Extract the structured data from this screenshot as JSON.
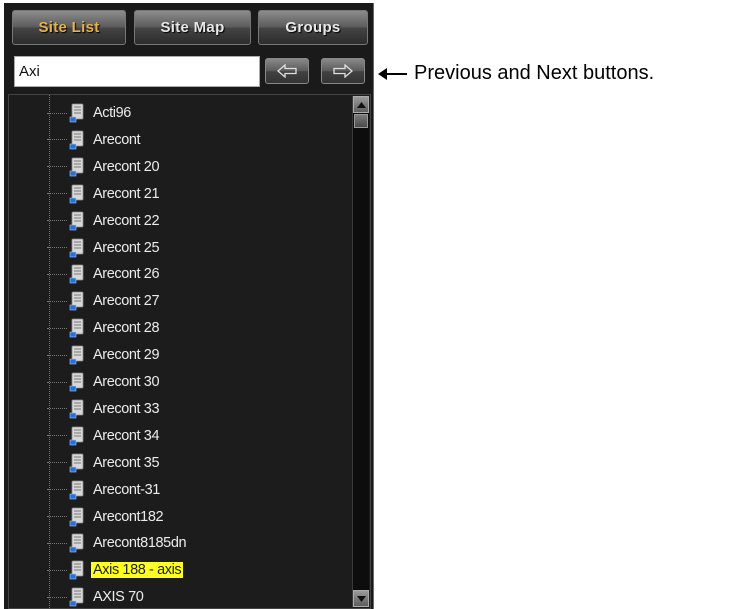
{
  "tabs": [
    {
      "label": "Site List",
      "active": true
    },
    {
      "label": "Site Map",
      "active": false
    },
    {
      "label": "Groups",
      "active": false
    }
  ],
  "search": {
    "value": "Axi"
  },
  "nav": {
    "prev_icon": "arrow-left-icon",
    "next_icon": "arrow-right-icon"
  },
  "annotation": {
    "text": "Previous and Next buttons."
  },
  "sites": [
    {
      "name": "Acti96",
      "highlighted": false
    },
    {
      "name": "Arecont",
      "highlighted": false
    },
    {
      "name": "Arecont 20",
      "highlighted": false
    },
    {
      "name": "Arecont 21",
      "highlighted": false
    },
    {
      "name": "Arecont 22",
      "highlighted": false
    },
    {
      "name": "Arecont 25",
      "highlighted": false
    },
    {
      "name": "Arecont 26",
      "highlighted": false
    },
    {
      "name": "Arecont 27",
      "highlighted": false
    },
    {
      "name": "Arecont 28",
      "highlighted": false
    },
    {
      "name": "Arecont 29",
      "highlighted": false
    },
    {
      "name": "Arecont 30",
      "highlighted": false
    },
    {
      "name": "Arecont 33",
      "highlighted": false
    },
    {
      "name": "Arecont 34",
      "highlighted": false
    },
    {
      "name": "Arecont 35",
      "highlighted": false
    },
    {
      "name": "Arecont-31",
      "highlighted": false
    },
    {
      "name": "Arecont182",
      "highlighted": false
    },
    {
      "name": "Arecont8185dn",
      "highlighted": false
    },
    {
      "name": "Axis 188 - axis",
      "highlighted": true
    },
    {
      "name": "AXIS 70",
      "highlighted": false
    }
  ],
  "colors": {
    "active_tab_text": "#e8b34a",
    "highlight": "#ffff26",
    "panel_bg": "#1a1a1a"
  }
}
